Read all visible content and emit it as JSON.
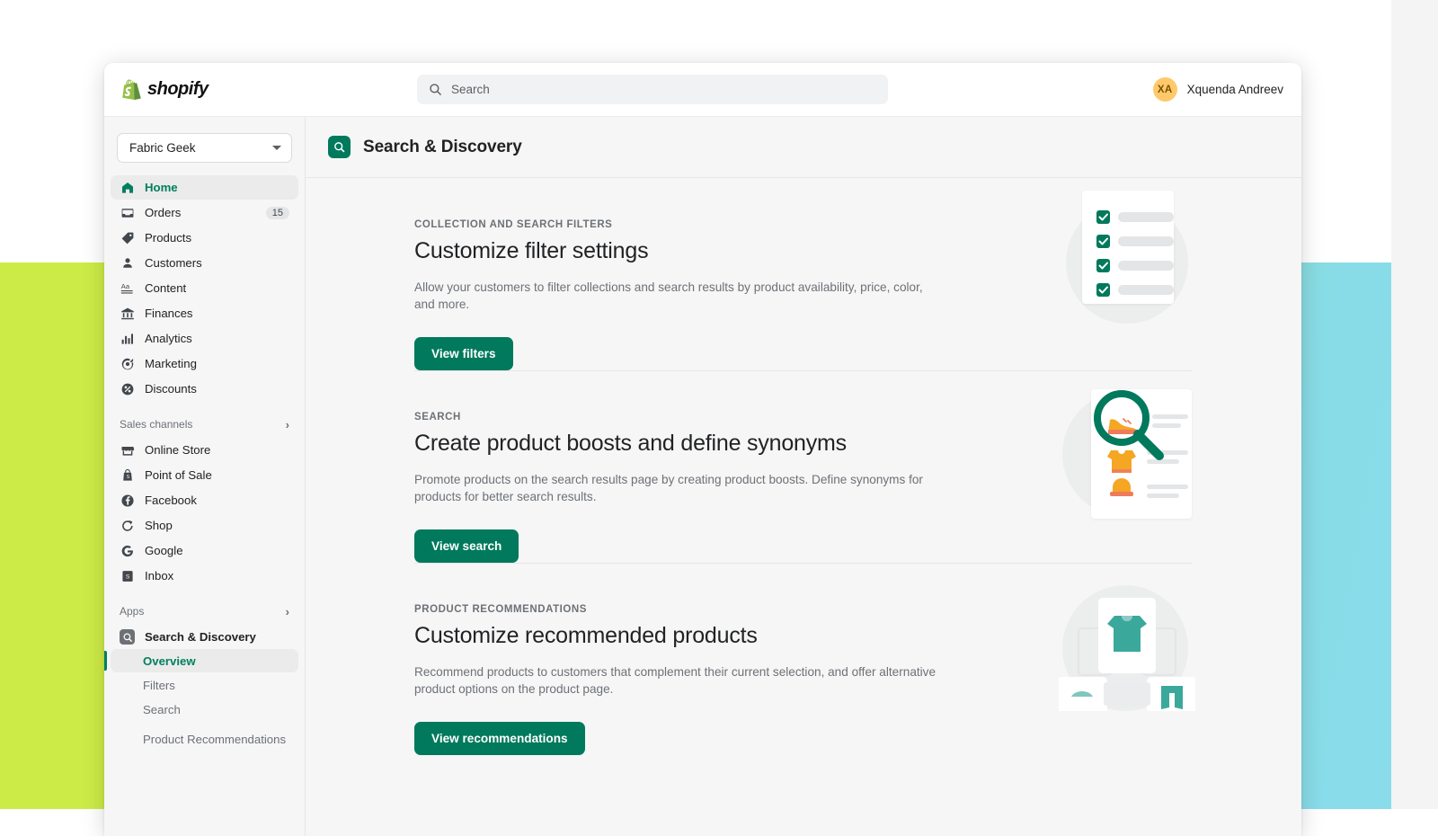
{
  "topbar": {
    "logo_text": "shopify",
    "logo_icon": "shopify-bag-icon",
    "search": {
      "placeholder": "Search",
      "value": "",
      "icon": "search-icon"
    },
    "user": {
      "initials": "XA",
      "name": "Xquenda Andreev"
    }
  },
  "sidebar": {
    "store_selector": {
      "label": "Fabric Geek",
      "icon": "chevron-down-icon"
    },
    "primary_items": [
      {
        "label": "Home",
        "icon": "home-icon",
        "active": true,
        "badge": ""
      },
      {
        "label": "Orders",
        "icon": "orders-icon",
        "active": false,
        "badge": "15"
      },
      {
        "label": "Products",
        "icon": "products-tag-icon",
        "active": false,
        "badge": ""
      },
      {
        "label": "Customers",
        "icon": "customers-icon",
        "active": false,
        "badge": ""
      },
      {
        "label": "Content",
        "icon": "content-aa-icon",
        "active": false,
        "badge": ""
      },
      {
        "label": "Finances",
        "icon": "finances-bank-icon",
        "active": false,
        "badge": ""
      },
      {
        "label": "Analytics",
        "icon": "analytics-bars-icon",
        "active": false,
        "badge": ""
      },
      {
        "label": "Marketing",
        "icon": "marketing-target-icon",
        "active": false,
        "badge": ""
      },
      {
        "label": "Discounts",
        "icon": "discounts-icon",
        "active": false,
        "badge": ""
      }
    ],
    "sales_channels": {
      "title": "Sales channels",
      "expand_icon": "chevron-right-icon",
      "items": [
        {
          "label": "Online Store",
          "icon": "storefront-icon"
        },
        {
          "label": "Point of Sale",
          "icon": "point-of-sale-icon"
        },
        {
          "label": "Facebook",
          "icon": "facebook-icon"
        },
        {
          "label": "Shop",
          "icon": "shop-icon"
        },
        {
          "label": "Google",
          "icon": "google-icon"
        },
        {
          "label": "Inbox",
          "icon": "inbox-icon"
        }
      ]
    },
    "apps": {
      "title": "Apps",
      "expand_icon": "chevron-right-icon",
      "app_name": "Search & Discovery",
      "app_icon": "search-discovery-icon",
      "sub_items": [
        {
          "label": "Overview",
          "active": true
        },
        {
          "label": "Filters",
          "active": false
        },
        {
          "label": "Search",
          "active": false
        },
        {
          "label": "Product Recommendations",
          "active": false
        }
      ]
    }
  },
  "page": {
    "icon": "search-discovery-icon",
    "title": "Search & Discovery"
  },
  "cards": [
    {
      "eyebrow": "COLLECTION AND SEARCH FILTERS",
      "heading": "Customize filter settings",
      "body": "Allow your customers to filter collections and search results by product availability, price, color, and more.",
      "button": "View filters",
      "illustration": "checklist-illustration"
    },
    {
      "eyebrow": "SEARCH",
      "heading": "Create product boosts and define synonyms",
      "body": "Promote products on the search results page by creating product boosts. Define synonyms for products for better search results.",
      "button": "View search",
      "illustration": "magnifier-products-illustration"
    },
    {
      "eyebrow": "PRODUCT RECOMMENDATIONS",
      "heading": "Customize recommended products",
      "body": "Recommend products to customers that complement their current selection, and offer alternative product options on the product page.",
      "button": "View recommendations",
      "illustration": "tshirt-recommendation-illustration"
    }
  ],
  "colors": {
    "brand_green": "#00795c",
    "active_green": "#007f5f",
    "accent_orange": "#f5a623",
    "accent_teal": "#3aa99b",
    "avatar_yellow": "#ffc96b",
    "bg_left": "#cdeb47",
    "bg_right": "#8adcea",
    "surface": "#f6f6f7"
  }
}
